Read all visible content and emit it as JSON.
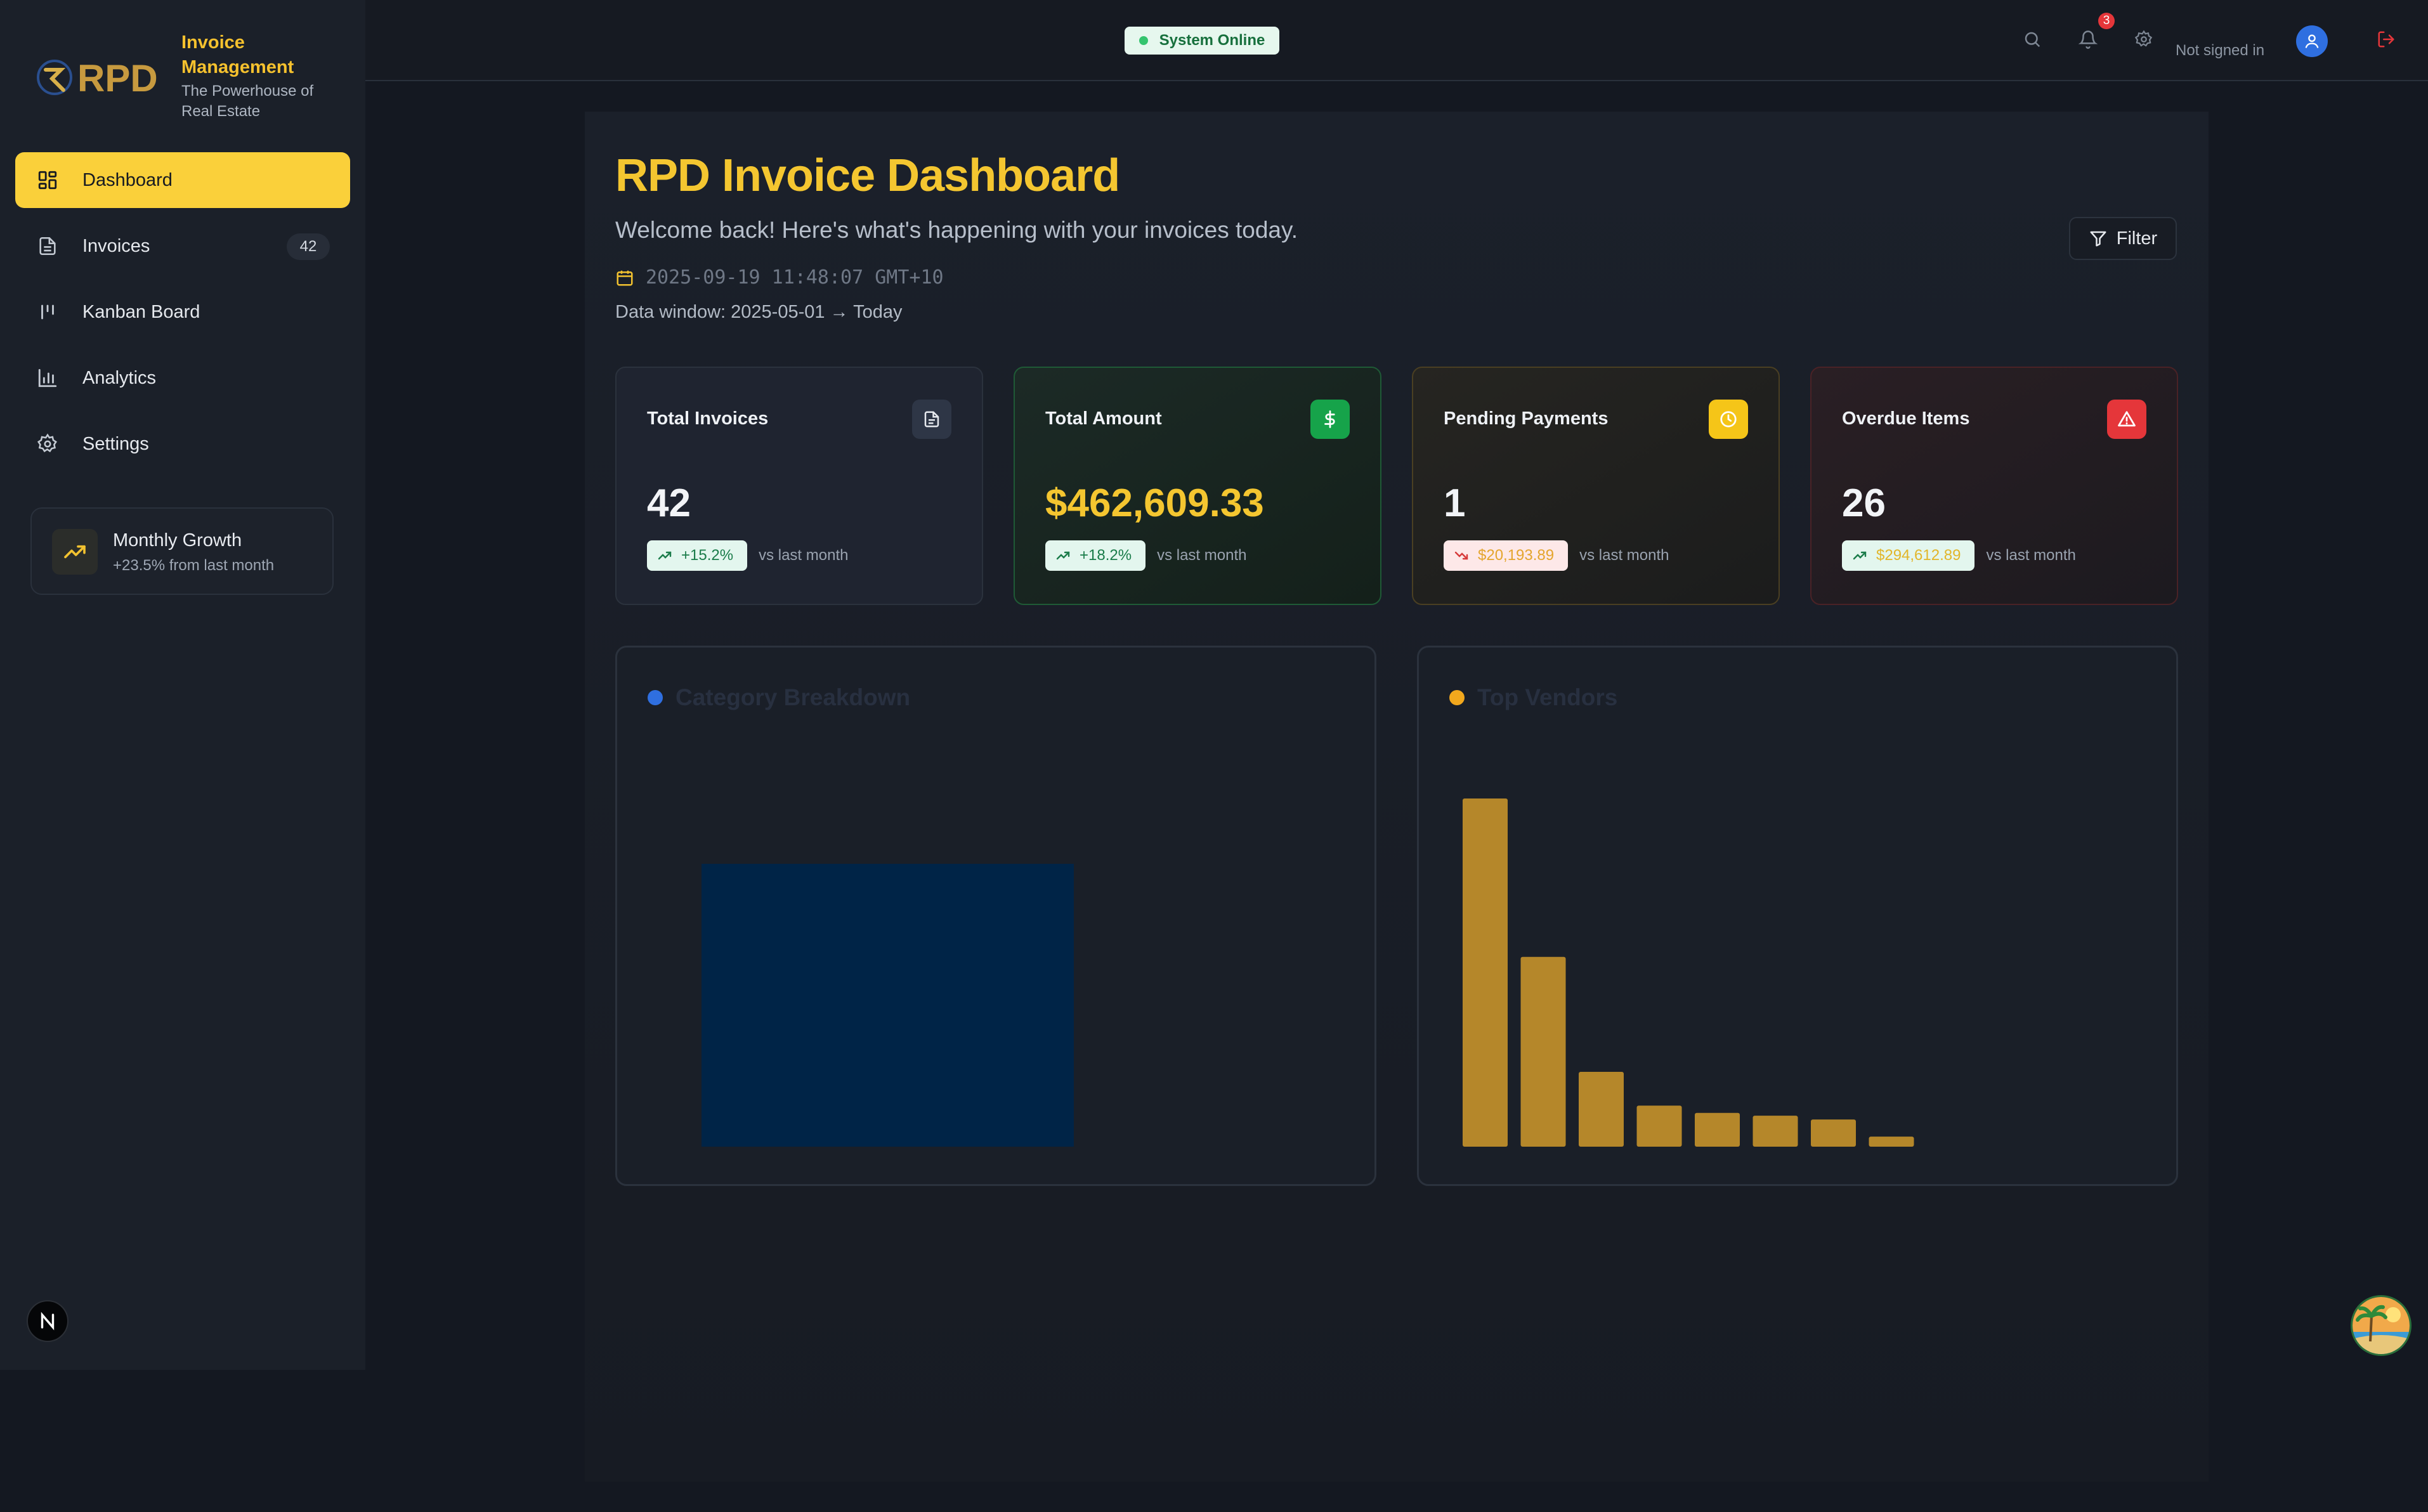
{
  "brand": {
    "logo_text": "RPD",
    "title": "Invoice Management",
    "subtitle": "The Powerhouse of Real Estate"
  },
  "sidebar": {
    "items": [
      {
        "label": "Dashboard",
        "icon": "dashboard-icon",
        "active": true
      },
      {
        "label": "Invoices",
        "icon": "document-icon",
        "badge": "42"
      },
      {
        "label": "Kanban Board",
        "icon": "kanban-icon"
      },
      {
        "label": "Analytics",
        "icon": "bar-chart-icon"
      },
      {
        "label": "Settings",
        "icon": "gear-icon"
      }
    ],
    "growth": {
      "title": "Monthly Growth",
      "subtitle": "+23.5% from last month"
    },
    "next_badge": "N"
  },
  "header": {
    "status": "System Online",
    "notifications": "3",
    "signin_text": "Not signed in"
  },
  "main": {
    "title": "RPD Invoice Dashboard",
    "welcome": "Welcome back! Here's what's happening with your invoices today.",
    "timestamp": "2025-09-19 11:48:07 GMT+10",
    "data_window": "Data window: 2025-05-01 → Today",
    "filter_label": "Filter"
  },
  "cards": [
    {
      "title": "Total Invoices",
      "value": "42",
      "trend": "+15.2%",
      "vs": "vs last month",
      "icon": "document-icon"
    },
    {
      "title": "Total Amount",
      "value": "$462,609.33",
      "trend": "+18.2%",
      "vs": "vs last month",
      "icon": "dollar-icon"
    },
    {
      "title": "Pending Payments",
      "value": "1",
      "trend": "$20,193.89",
      "vs": "vs last month",
      "icon": "clock-icon"
    },
    {
      "title": "Overdue Items",
      "value": "26",
      "trend": "$294,612.89",
      "vs": "vs last month",
      "icon": "alert-triangle-icon"
    }
  ],
  "colors": {
    "accent": "#fad03a",
    "green": "#16a34a",
    "red": "#e5363a",
    "category_bar": "#002447",
    "vendor_bar": "#b5872a",
    "category_dot": "#2f6fe0",
    "vendor_dot": "#f2a81d"
  },
  "chart_data": [
    {
      "type": "bar",
      "title": "Category Breakdown",
      "categories": [
        ""
      ],
      "values": [
        1
      ]
    },
    {
      "type": "bar",
      "title": "Top Vendors",
      "categories": [
        "",
        "",
        "",
        "",
        "",
        "",
        "",
        ""
      ],
      "values": [
        100,
        54.5,
        21.5,
        11.8,
        9.7,
        8.9,
        7.8,
        2.9
      ]
    }
  ]
}
